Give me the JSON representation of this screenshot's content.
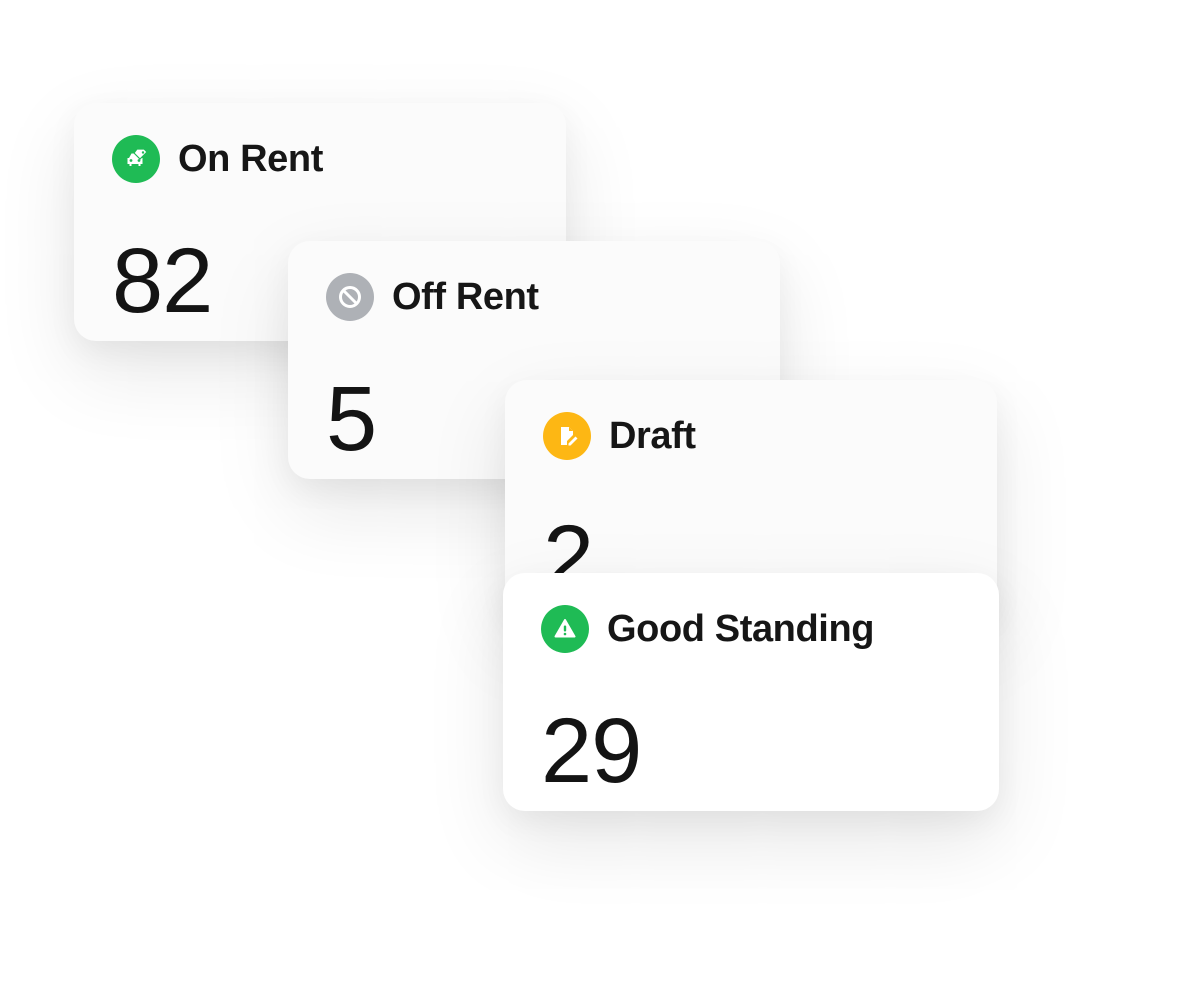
{
  "cards": [
    {
      "label": "On Rent",
      "value": "82",
      "icon": "car-tag-icon",
      "icon_color": "#1fbb55"
    },
    {
      "label": "Off Rent",
      "value": "5",
      "icon": "prohibited-icon",
      "icon_color": "#aeb1b6"
    },
    {
      "label": "Draft",
      "value": "2",
      "icon": "document-edit-icon",
      "icon_color": "#fdb714"
    },
    {
      "label": "Good Standing",
      "value": "29",
      "icon": "warning-triangle-icon",
      "icon_color": "#1fbb55"
    }
  ]
}
